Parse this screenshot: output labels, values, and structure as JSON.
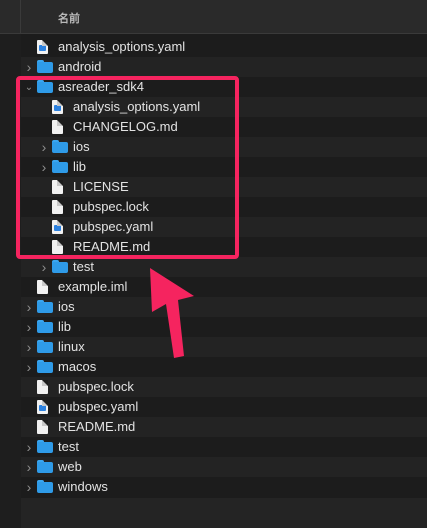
{
  "header": {
    "column_label": "名前"
  },
  "rows": [
    {
      "name": "analysis_options.yaml",
      "type": "yaml",
      "indent": 0,
      "disclosure": ""
    },
    {
      "name": "android",
      "type": "folder",
      "indent": 0,
      "disclosure": "collapsed"
    },
    {
      "name": "asreader_sdk4",
      "type": "folder",
      "indent": 0,
      "disclosure": "expanded"
    },
    {
      "name": "analysis_options.yaml",
      "type": "yaml",
      "indent": 1,
      "disclosure": ""
    },
    {
      "name": "CHANGELOG.md",
      "type": "doc",
      "indent": 1,
      "disclosure": ""
    },
    {
      "name": "ios",
      "type": "folder",
      "indent": 1,
      "disclosure": "collapsed"
    },
    {
      "name": "lib",
      "type": "folder",
      "indent": 1,
      "disclosure": "collapsed"
    },
    {
      "name": "LICENSE",
      "type": "doc",
      "indent": 1,
      "disclosure": ""
    },
    {
      "name": "pubspec.lock",
      "type": "doc",
      "indent": 1,
      "disclosure": ""
    },
    {
      "name": "pubspec.yaml",
      "type": "yaml",
      "indent": 1,
      "disclosure": ""
    },
    {
      "name": "README.md",
      "type": "doc",
      "indent": 1,
      "disclosure": ""
    },
    {
      "name": "test",
      "type": "folder",
      "indent": 1,
      "disclosure": "collapsed"
    },
    {
      "name": "example.iml",
      "type": "doc",
      "indent": 0,
      "disclosure": ""
    },
    {
      "name": "ios",
      "type": "folder",
      "indent": 0,
      "disclosure": "collapsed"
    },
    {
      "name": "lib",
      "type": "folder",
      "indent": 0,
      "disclosure": "collapsed"
    },
    {
      "name": "linux",
      "type": "folder",
      "indent": 0,
      "disclosure": "collapsed"
    },
    {
      "name": "macos",
      "type": "folder",
      "indent": 0,
      "disclosure": "collapsed"
    },
    {
      "name": "pubspec.lock",
      "type": "doc",
      "indent": 0,
      "disclosure": ""
    },
    {
      "name": "pubspec.yaml",
      "type": "yaml",
      "indent": 0,
      "disclosure": ""
    },
    {
      "name": "README.md",
      "type": "doc",
      "indent": 0,
      "disclosure": ""
    },
    {
      "name": "test",
      "type": "folder",
      "indent": 0,
      "disclosure": "collapsed"
    },
    {
      "name": "web",
      "type": "folder",
      "indent": 0,
      "disclosure": "collapsed"
    },
    {
      "name": "windows",
      "type": "folder",
      "indent": 0,
      "disclosure": "collapsed"
    }
  ],
  "annotation": {
    "highlight_color": "#f5245f",
    "arrow_color": "#f5245f"
  }
}
